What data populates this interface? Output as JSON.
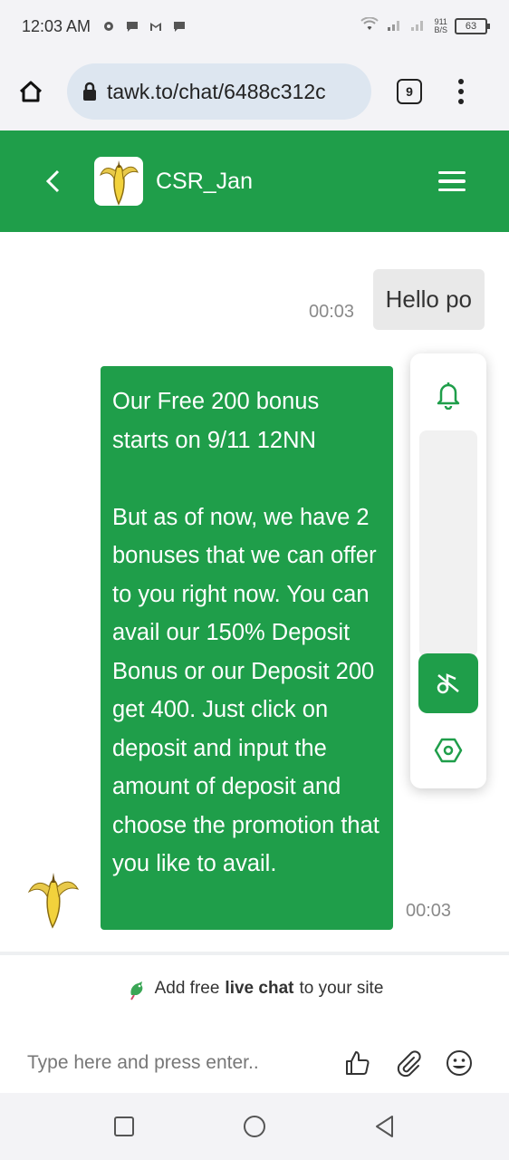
{
  "status_bar": {
    "time": "12:03 AM",
    "net_speed_value": "911",
    "net_speed_unit": "B/S",
    "battery": "63",
    "icons": [
      "gear-icon",
      "chat-bubble-icon",
      "gmail-icon",
      "chat-bubble-icon",
      "wifi-icon",
      "signal-icon",
      "signal-icon",
      "battery-icon"
    ]
  },
  "browser": {
    "url": "tawk.to/chat/6488c312c",
    "tab_count": "9"
  },
  "chat_header": {
    "agent_name": "CSR_Jan"
  },
  "messages": [
    {
      "sender": "visitor",
      "text": "Hello po",
      "time": "00:03"
    },
    {
      "sender": "agent",
      "text": "Our Free 200 bonus starts on 9/11 12NN\n\nBut as of now, we have 2 bonuses that we can offer to you right now. You can avail our 150% Deposit Bonus or our Deposit 200 get 400. Just click on deposit and input the amount of deposit and choose the promotion that you like to avail.",
      "time": "00:03"
    }
  ],
  "footer": {
    "branding_prefix": "Add free",
    "branding_bold": "live chat",
    "branding_suffix": "to your site",
    "input_placeholder": "Type here and press enter.."
  },
  "colors": {
    "brand_green": "#1f9e4a",
    "visitor_bubble": "#e9e9e9",
    "bar_background": "#f3f3f6",
    "url_pill": "#dde6f0"
  }
}
